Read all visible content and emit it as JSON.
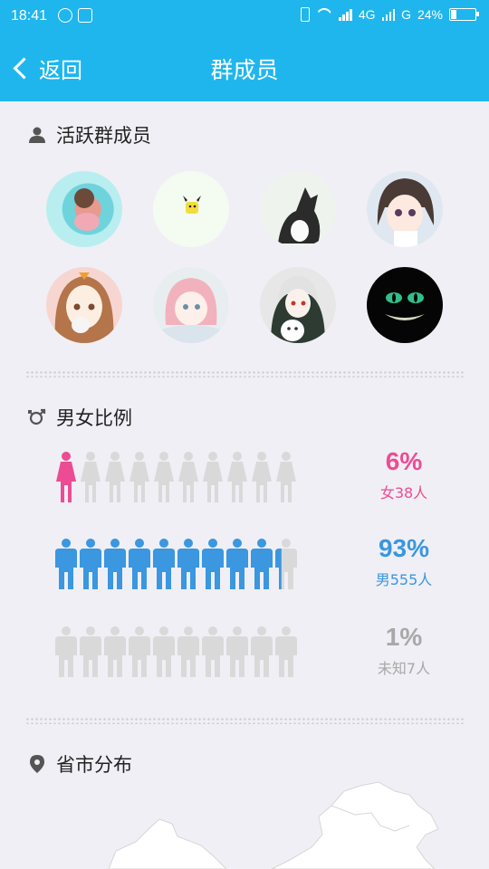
{
  "status_bar": {
    "time": "18:41",
    "network_1": "4G",
    "network_2": "G",
    "battery": "24%",
    "battery_level": 0.24
  },
  "nav": {
    "back_label": "返回",
    "title": "群成员"
  },
  "active_members": {
    "heading": "活跃群成员",
    "icon": "person-icon"
  },
  "gender": {
    "heading": "男女比例",
    "icon": "gender-icon",
    "rows": [
      {
        "percent": "6%",
        "label": "女38人",
        "color": "#ec4c93",
        "filled_icons": 1,
        "kind": "female"
      },
      {
        "percent": "93%",
        "label": "男555人",
        "color": "#3a97e0",
        "filled_icons": 9.3,
        "kind": "male"
      },
      {
        "percent": "1%",
        "label": "未知7人",
        "color": "#a8a8a8",
        "filled_icons": 0,
        "kind": "unknown"
      }
    ],
    "empty_color": "#d9d9d9"
  },
  "province": {
    "heading": "省市分布",
    "icon": "location-pin-icon"
  },
  "colors": {
    "header": "#1fb6ee",
    "background": "#f0eff5"
  }
}
